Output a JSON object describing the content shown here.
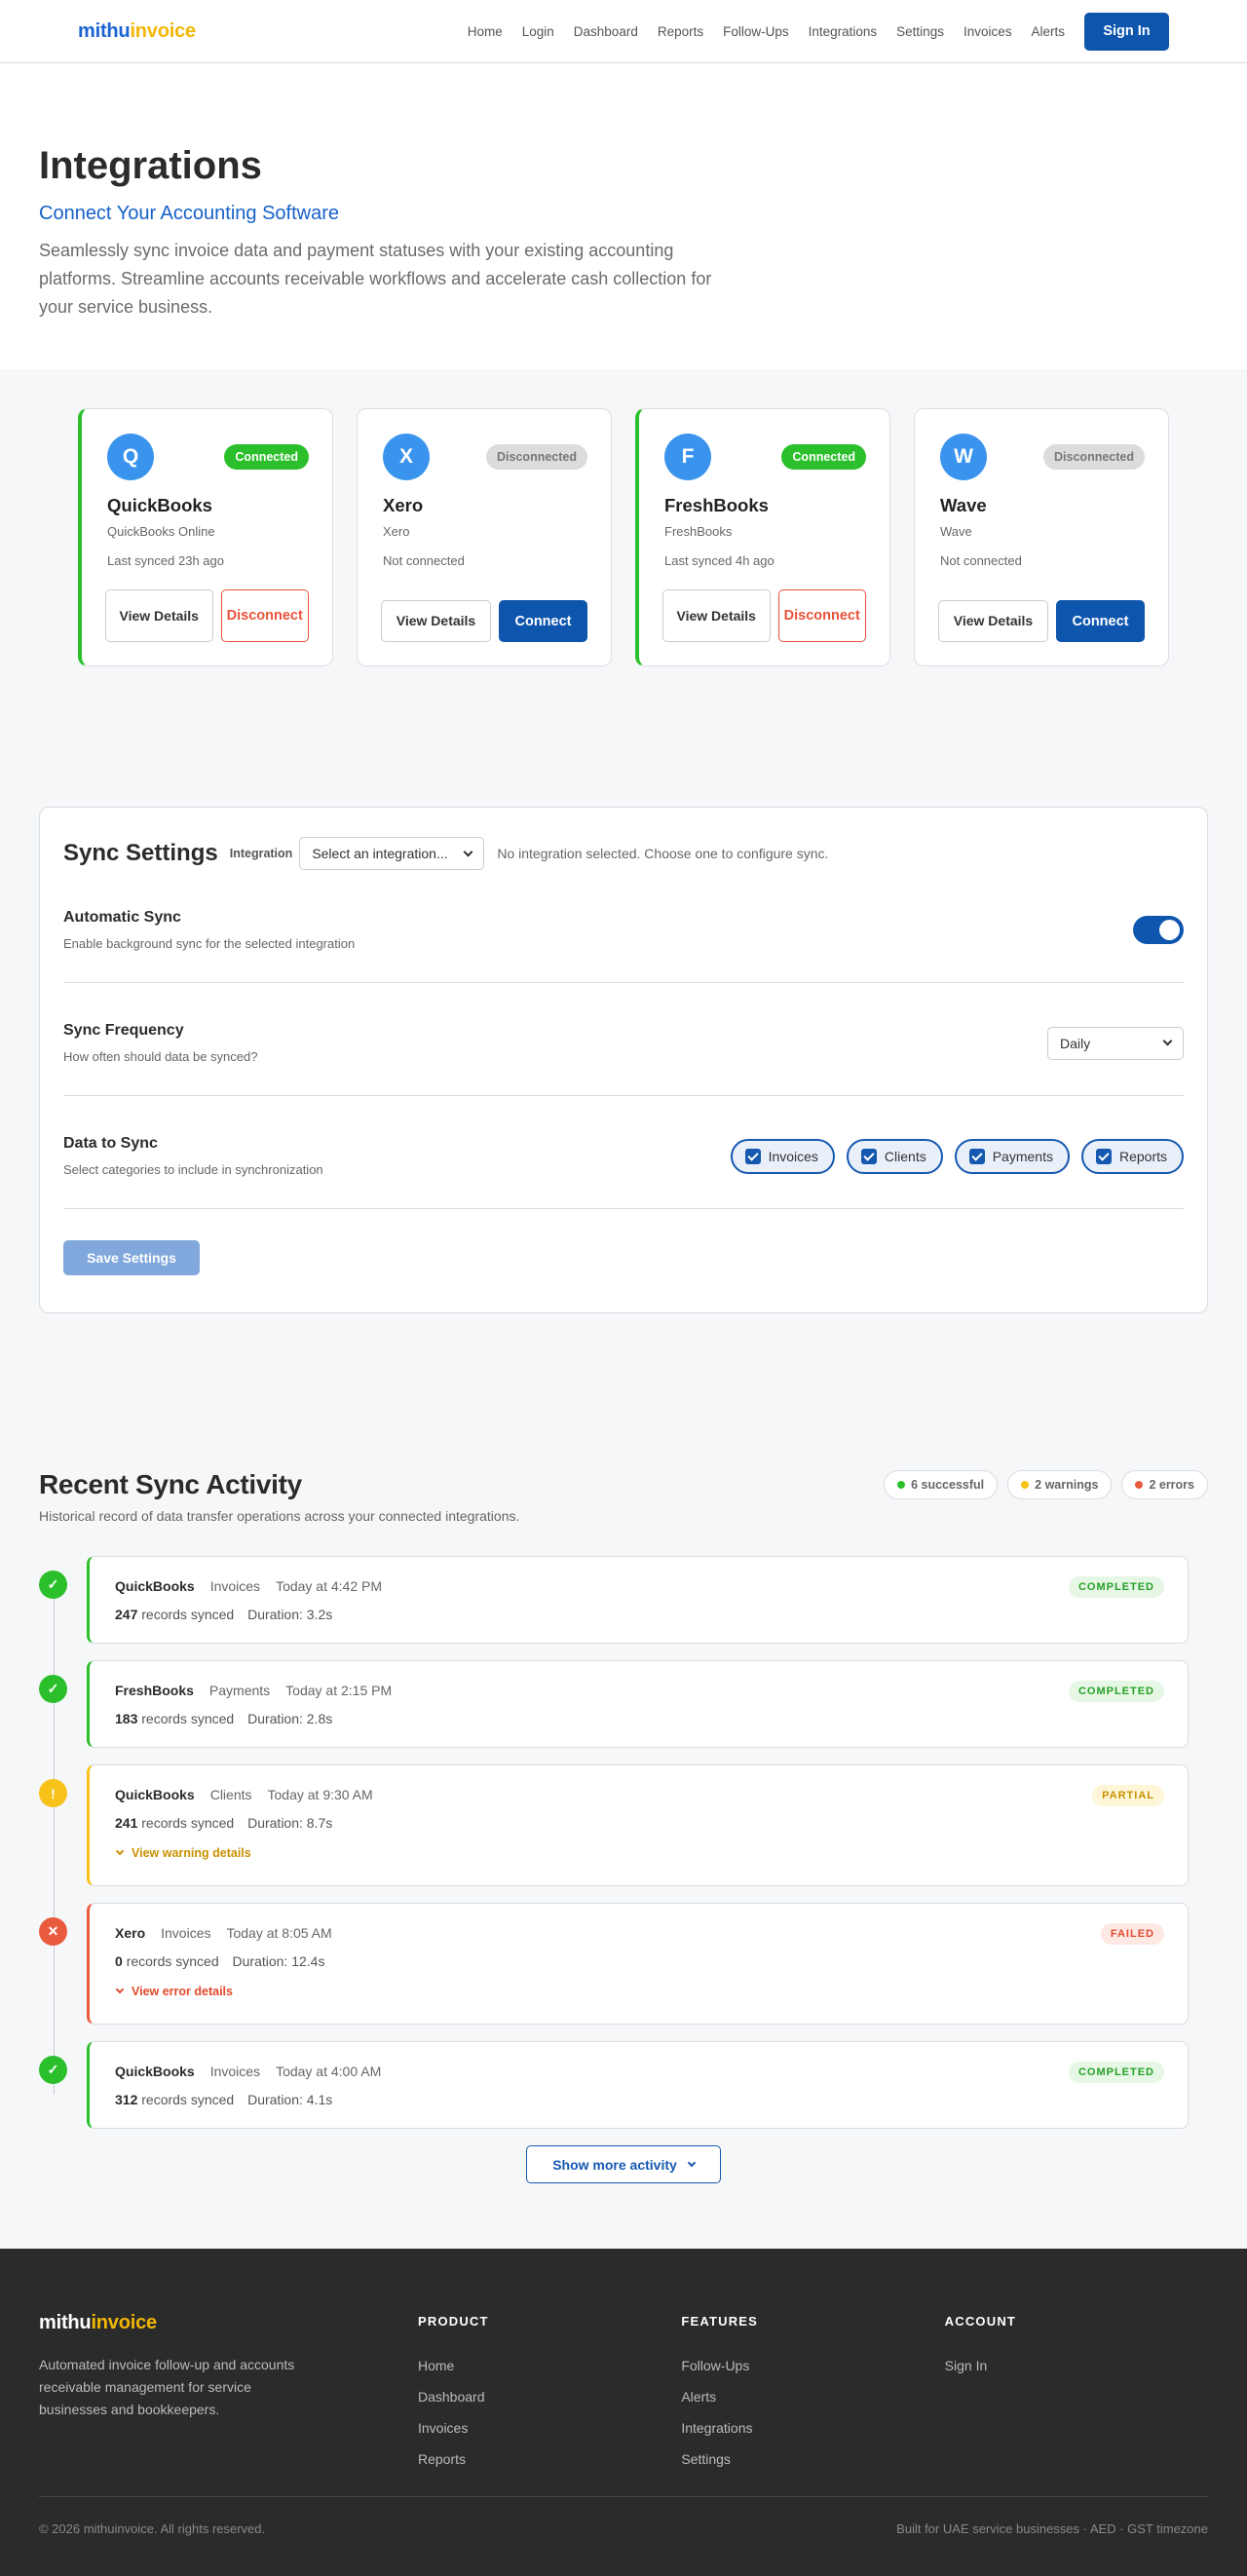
{
  "header": {
    "logo_a": "mithu",
    "logo_b": "invoice",
    "nav": [
      "Home",
      "Login",
      "Dashboard",
      "Reports",
      "Follow-Ups",
      "Integrations",
      "Settings",
      "Invoices",
      "Alerts"
    ],
    "signin_label": "Sign In"
  },
  "hero": {
    "title": "Integrations",
    "subtitle": "Connect Your Accounting Software",
    "description": "Seamlessly sync invoice data and payment statuses with your existing accounting platforms. Streamline accounts receivable workflows and accelerate cash collection for your service business."
  },
  "integrations": [
    {
      "initial": "Q",
      "name": "QuickBooks",
      "product": "QuickBooks Online",
      "status": "Connected",
      "sync": "Last synced 23h ago",
      "view_label": "View Details",
      "action_label": "Disconnect"
    },
    {
      "initial": "X",
      "name": "Xero",
      "product": "Xero",
      "status": "Disconnected",
      "sync": "Not connected",
      "view_label": "View Details",
      "action_label": "Connect"
    },
    {
      "initial": "F",
      "name": "FreshBooks",
      "product": "FreshBooks",
      "status": "Connected",
      "sync": "Last synced 4h ago",
      "view_label": "View Details",
      "action_label": "Disconnect"
    },
    {
      "initial": "W",
      "name": "Wave",
      "product": "Wave",
      "status": "Disconnected",
      "sync": "Not connected",
      "view_label": "View Details",
      "action_label": "Connect"
    }
  ],
  "settings": {
    "title": "Sync Settings",
    "integration_label": "Integration",
    "integration_select": "Select an integration...",
    "note": "No integration selected. Choose one to configure sync.",
    "auto_title": "Automatic Sync",
    "auto_desc": "Enable background sync for the selected integration",
    "auto_enabled": true,
    "freq_title": "Sync Frequency",
    "freq_desc": "How often should data be synced?",
    "freq_value": "Daily",
    "data_title": "Data to Sync",
    "data_desc": "Select categories to include in synchronization",
    "data_options": [
      "Invoices",
      "Clients",
      "Payments",
      "Reports"
    ],
    "save_label": "Save Settings"
  },
  "activity": {
    "title": "Recent Sync Activity",
    "description": "Historical record of data transfer operations across your connected integrations.",
    "summary": {
      "success": "6 successful",
      "warnings": "2 warnings",
      "errors": "2 errors"
    },
    "colors": {
      "success": "#2bc02b",
      "warning": "#f7c21a",
      "error": "#ea5a3d"
    },
    "records_suffix": "records synced",
    "items": [
      {
        "source": "QuickBooks",
        "category": "Invoices",
        "time": "Today at 4:42 PM",
        "records": "247",
        "duration": "Duration: 3.2s",
        "status": "COMPLETED",
        "kind": "success"
      },
      {
        "source": "FreshBooks",
        "category": "Payments",
        "time": "Today at 2:15 PM",
        "records": "183",
        "duration": "Duration: 2.8s",
        "status": "COMPLETED",
        "kind": "success"
      },
      {
        "source": "QuickBooks",
        "category": "Clients",
        "time": "Today at 9:30 AM",
        "records": "241",
        "duration": "Duration: 8.7s",
        "status": "PARTIAL",
        "kind": "warning",
        "link": "View warning details"
      },
      {
        "source": "Xero",
        "category": "Invoices",
        "time": "Today at 8:05 AM",
        "records": "0",
        "duration": "Duration: 12.4s",
        "status": "FAILED",
        "kind": "error",
        "link": "View error details"
      },
      {
        "source": "QuickBooks",
        "category": "Invoices",
        "time": "Today at 4:00 AM",
        "records": "312",
        "duration": "Duration: 4.1s",
        "status": "COMPLETED",
        "kind": "success"
      }
    ],
    "more_label": "Show more activity"
  },
  "footer": {
    "logo_a": "mithu",
    "logo_b": "invoice",
    "tagline": "Automated invoice follow-up and accounts receivable management for service businesses and bookkeepers.",
    "columns": [
      {
        "title": "PRODUCT",
        "links": [
          "Home",
          "Dashboard",
          "Invoices",
          "Reports"
        ]
      },
      {
        "title": "FEATURES",
        "links": [
          "Follow-Ups",
          "Alerts",
          "Integrations",
          "Settings"
        ]
      },
      {
        "title": "ACCOUNT",
        "links": [
          "Sign In"
        ]
      }
    ],
    "copyright": "© 2026 mithuinvoice. All rights reserved.",
    "locale": "Built for UAE service businesses · AED · GST timezone"
  }
}
